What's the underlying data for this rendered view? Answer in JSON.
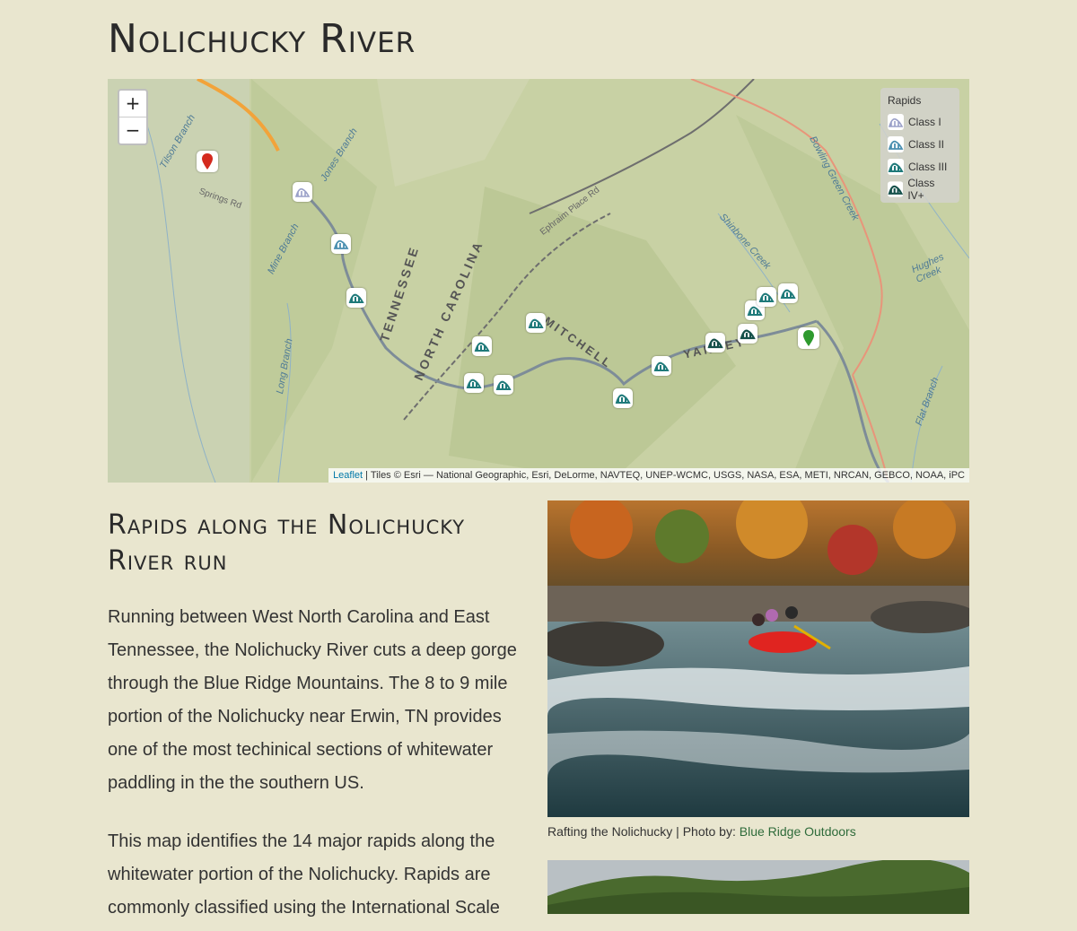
{
  "page": {
    "title": "Nolichucky River"
  },
  "map": {
    "zoom_in": "+",
    "zoom_out": "−",
    "place_labels": [
      "Tennessee",
      "North Carolina",
      "Mitchell",
      "Yancey",
      "Jones Branch",
      "Mine Branch",
      "Long Branch",
      "Shinbone Creek",
      "Bowling Green Creek",
      "Hughes Creek",
      "Flat Branch",
      "Ephraim Place Rd",
      "Tilson Branch",
      "Springs Rd"
    ],
    "legend": {
      "title": "Rapids",
      "items": [
        {
          "label": "Class I",
          "color": "#9aa0c8"
        },
        {
          "label": "Class II",
          "color": "#4a8fb0"
        },
        {
          "label": "Class III",
          "color": "#1f7a7a"
        },
        {
          "label": "Class IV+",
          "color": "#14504a"
        }
      ]
    },
    "attribution": {
      "leaflet": "Leaflet",
      "text": " | Tiles © Esri — National Geographic, Esri, DeLorme, NAVTEQ, UNEP-WCMC, USGS, NASA, ESA, METI, NRCAN, GEBCO, NOAA, iPC"
    },
    "colors": {
      "start_pin": "#d42a1e",
      "end_pin": "#2e9a2e"
    }
  },
  "section": {
    "heading": "Rapids along the Nolichucky River run",
    "paragraphs": [
      "Running between West North Carolina and East Tennessee, the Nolichucky River cuts a deep gorge through the Blue Ridge Mountains. The 8 to 9 mile portion of the Nolichucky near Erwin, TN provides one of the most techinical sections of whitewater paddling in the the southern US.",
      "This map identifies the 14 major rapids along the whitewater portion of the Nolichucky. Rapids are commonly classified using the International Scale"
    ]
  },
  "photo": {
    "caption_text": "Rafting the Nolichucky | Photo by: ",
    "caption_link": "Blue Ridge Outdoors"
  }
}
